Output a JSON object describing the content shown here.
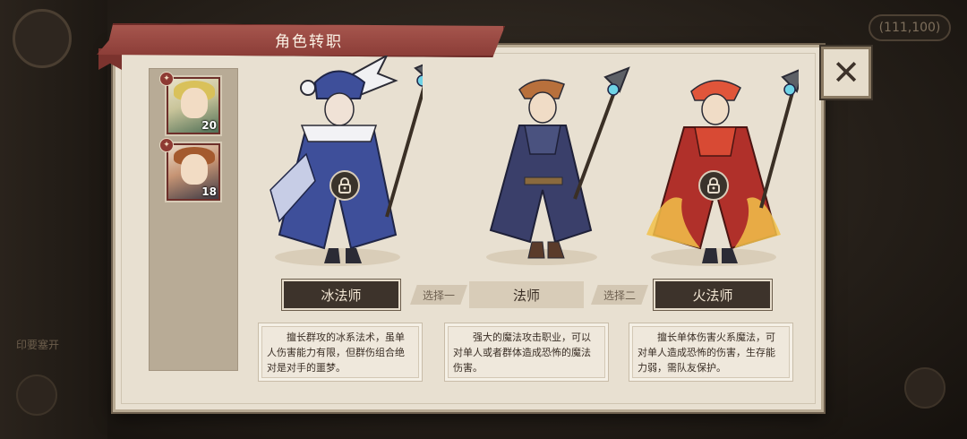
{
  "title": "角色转职",
  "hud": {
    "counter": "(111,100)",
    "side_label": "印要塞开"
  },
  "heroes": [
    {
      "level": "20"
    },
    {
      "level": "18"
    }
  ],
  "classes": [
    {
      "name": "冰法师",
      "description": "擅长群攻的冰系法术，虽单人伤害能力有限，但群伤组合绝对是对手的噩梦。",
      "locked": true
    },
    {
      "name": "法师",
      "description": "强大的魔法攻击职业，可以对单人或者群体造成恐怖的魔法伤害。",
      "locked": false
    },
    {
      "name": "火法师",
      "description": "擅长单体伤害火系魔法，可对单人造成恐怖的伤害，生存能力弱，需队友保护。",
      "locked": true
    }
  ],
  "choices": [
    "选择一",
    "选择二"
  ],
  "colors": {
    "ribbon": "#8a3c36",
    "panel": "#e8e0d1",
    "button_dark": "#3d332b",
    "ice_robe": "#3e4f9a",
    "mage_robe": "#3a3f6a",
    "fire_robe": "#b0302a"
  },
  "icons": {
    "close": "close-icon",
    "lock": "lock-icon",
    "badge": "emblem-icon"
  }
}
